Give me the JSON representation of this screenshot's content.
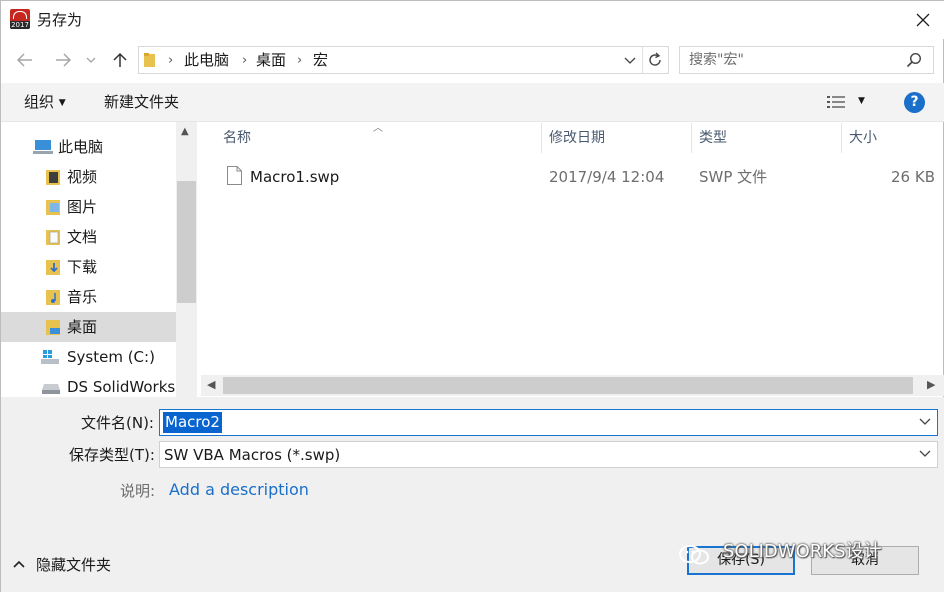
{
  "window": {
    "title": "另存为"
  },
  "address": {
    "crumbs": [
      "此电脑",
      "桌面",
      "宏"
    ]
  },
  "search": {
    "placeholder": "搜索\"宏\""
  },
  "toolbar": {
    "organize": "组织",
    "new_folder": "新建文件夹"
  },
  "nav": {
    "items": [
      {
        "label": "此电脑",
        "icon": "computer-icon"
      },
      {
        "label": "视频",
        "icon": "video-folder-icon"
      },
      {
        "label": "图片",
        "icon": "pictures-folder-icon"
      },
      {
        "label": "文档",
        "icon": "documents-folder-icon"
      },
      {
        "label": "下载",
        "icon": "downloads-folder-icon"
      },
      {
        "label": "音乐",
        "icon": "music-folder-icon"
      },
      {
        "label": "桌面",
        "icon": "desktop-folder-icon",
        "selected": true
      },
      {
        "label": "System (C:)",
        "icon": "windows-drive-icon"
      },
      {
        "label": "DS SolidWorks",
        "icon": "drive-icon"
      }
    ]
  },
  "columns": {
    "name": "名称",
    "modified": "修改日期",
    "type": "类型",
    "size": "大小"
  },
  "files": [
    {
      "name": "Macro1.swp",
      "modified": "2017/9/4 12:04",
      "type": "SWP 文件",
      "size": "26 KB"
    }
  ],
  "form": {
    "filename_label": "文件名(N):",
    "filename_value": "Macro2",
    "filetype_label": "保存类型(T):",
    "filetype_value": "SW VBA Macros (*.swp)",
    "desc_label": "说明:",
    "desc_link": "Add a description"
  },
  "footer": {
    "hide_folders": "隐藏文件夹",
    "save": "保存(S)",
    "cancel": "取消",
    "watermark": "SOLIDWORKS设计"
  },
  "colors": {
    "accent": "#1874d1",
    "selection": "#0a64d0",
    "link": "#1a6fc9"
  }
}
